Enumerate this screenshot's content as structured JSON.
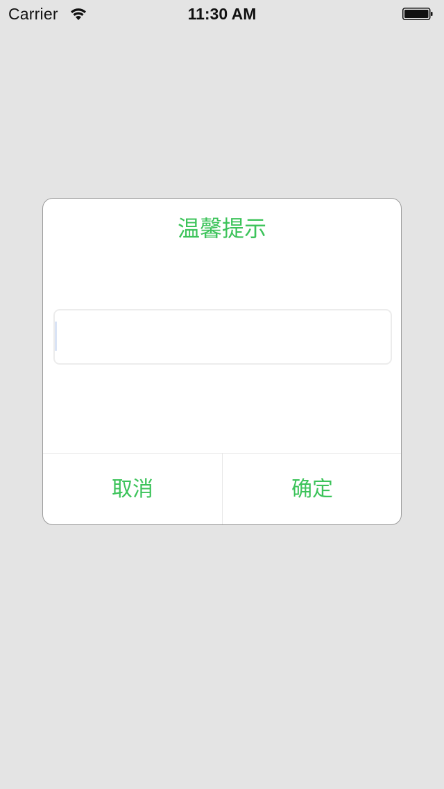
{
  "status_bar": {
    "carrier": "Carrier",
    "time": "11:30 AM",
    "wifi_icon": "wifi-icon",
    "battery_icon": "battery-icon"
  },
  "dialog": {
    "title": "温馨提示",
    "input": {
      "value": "",
      "placeholder": ""
    },
    "cancel_label": "取消",
    "confirm_label": "确定",
    "accent_color": "#3cc35a"
  }
}
